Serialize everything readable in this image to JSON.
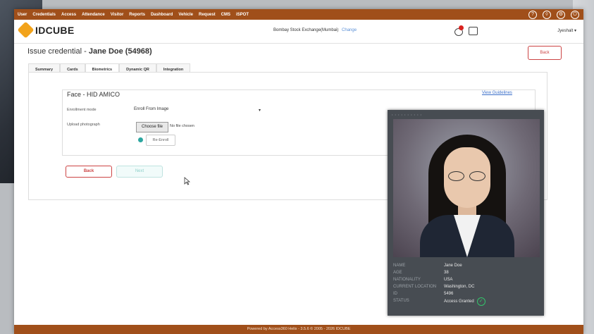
{
  "topnav": {
    "items": [
      "User",
      "Credentials",
      "Access",
      "Attendance",
      "Visitor",
      "Reports",
      "Dashboard",
      "Vehicle",
      "Request",
      "CMS",
      "iSPOT"
    ],
    "right_icons": [
      "help-icon",
      "shield-icon",
      "gear-icon",
      "power-icon"
    ]
  },
  "header": {
    "logo_text": "IDCUBE",
    "organization": "Bombay Stock Exchange(Mumbai)",
    "change_link": "Change",
    "user": "Jyeshalt ▾"
  },
  "page": {
    "title_prefix": "Issue credential - ",
    "title_name": "Jane Doe (54968)",
    "back_top": "Back"
  },
  "tabs": [
    "Summary",
    "Cards",
    "Biometrics",
    "Dynamic QR",
    "Integration"
  ],
  "face_section": {
    "title": "Face - HID AMICO",
    "view_guidelines": "View Guidelines",
    "enrollment_mode_label": "Enrollment mode",
    "enrollment_mode_value": "Enroll From Image",
    "upload_label": "Upload photograph",
    "choose_file": "Choose file",
    "no_file": "No file chosen",
    "re_enroll": "Re-Enroll"
  },
  "buttons": {
    "back": "Back",
    "next": "Next"
  },
  "footer": "Powered by Access360 Helix - 3.5.6 © 2005 - 2026 IDCUBE",
  "id_card": {
    "rows": [
      {
        "k": "NAME",
        "v": "Jane Doe"
      },
      {
        "k": "AGE",
        "v": "38"
      },
      {
        "k": "NATIONALITY",
        "v": "USA"
      },
      {
        "k": "CURRENT LOCATION",
        "v": "Washington, DC"
      },
      {
        "k": "ID",
        "v": "5496"
      },
      {
        "k": "STATUS",
        "v": "Access Granted"
      }
    ]
  },
  "colors": {
    "brand": "#a04f1a",
    "accent": "#c44444",
    "teal": "#2ca6a0",
    "granted": "#33c46b"
  }
}
